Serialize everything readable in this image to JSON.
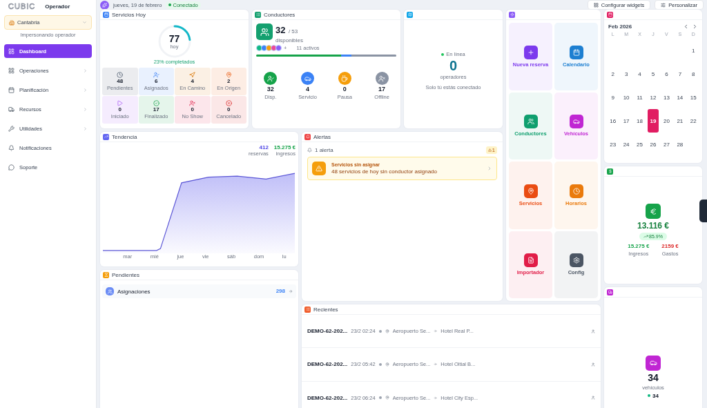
{
  "sidebar": {
    "logo": "CUBIC",
    "role": "Operador",
    "company": {
      "name": "Cantabria",
      "note": "Impersonando operador"
    },
    "items": [
      {
        "label": "Dashboard",
        "selected": true,
        "submenu": false
      },
      {
        "label": "Operaciones",
        "selected": false,
        "submenu": true
      },
      {
        "label": "Planificación",
        "selected": false,
        "submenu": true
      },
      {
        "label": "Recursos",
        "selected": false,
        "submenu": true
      },
      {
        "label": "Utilidades",
        "selected": false,
        "submenu": true
      },
      {
        "label": "Notificaciones",
        "selected": false,
        "submenu": false
      },
      {
        "label": "Soporte",
        "selected": false,
        "submenu": false
      }
    ]
  },
  "header": {
    "date": "jueves, 19 de febrero",
    "status": "Conectado",
    "buttons": [
      {
        "label": "Configurar widgets"
      },
      {
        "label": "Personalizar"
      }
    ]
  },
  "services": {
    "title": "Servicios Hoy",
    "total": "77",
    "total_note": "hoy",
    "level": 0.23,
    "progress": "23% completados",
    "tiles": [
      {
        "kind": "clock",
        "value": "48",
        "label": "Pendientes"
      },
      {
        "kind": "user-check",
        "value": "6",
        "label": "Asignados"
      },
      {
        "kind": "navigation",
        "value": "4",
        "label": "En Camino"
      },
      {
        "kind": "pin",
        "value": "2",
        "label": "En Origen"
      },
      {
        "kind": "play",
        "value": "0",
        "label": "Iniciado"
      },
      {
        "kind": "check",
        "value": "17",
        "label": "Finalizado"
      },
      {
        "kind": "user-x",
        "value": "0",
        "label": "No Show"
      },
      {
        "kind": "x",
        "value": "0",
        "label": "Cancelado"
      }
    ]
  },
  "drivers": {
    "title": "Conductores",
    "available": "32",
    "total": "/ 53",
    "available_label": "disponibles",
    "avatars": [
      {
        "color": "#10b981"
      },
      {
        "color": "#3b82f6"
      },
      {
        "color": "#f59e0b"
      },
      {
        "color": "#ec4899"
      },
      {
        "color": "#8b5cf6"
      }
    ],
    "more": "+",
    "active": "11 activos",
    "stats": [
      {
        "kind": "user-check",
        "value": "32",
        "label": "Disp.",
        "color": "#16a34a"
      },
      {
        "kind": "car",
        "value": "4",
        "label": "Servicio",
        "color": "#3b82f6"
      },
      {
        "kind": "coffee",
        "value": "0",
        "label": "Pausa",
        "color": "#f59e0b"
      },
      {
        "kind": "user-x",
        "value": "17",
        "label": "Offline",
        "color": "#8a93a3"
      }
    ]
  },
  "online": {
    "status": "En línea",
    "count": "0",
    "label": "operadores",
    "note": "Solo tú estás conectado"
  },
  "actions": [
    {
      "kind": "plus",
      "label": "Nueva reserva",
      "color": "#7c3aed"
    },
    {
      "kind": "calendar",
      "label": "Calendario",
      "color": "#1d7fd1"
    },
    {
      "kind": "users",
      "label": "Conductores",
      "color": "#0f9f6e"
    },
    {
      "kind": "car",
      "label": "Vehículos",
      "color": "#c026d3"
    },
    {
      "kind": "pin",
      "label": "Servicios",
      "color": "#ea4c12"
    },
    {
      "kind": "clock",
      "label": "Horarios",
      "color": "#ea7a0c"
    },
    {
      "kind": "file",
      "label": "Importador",
      "color": "#e11d48"
    },
    {
      "kind": "settings",
      "label": "Config",
      "color": "#4b5563"
    }
  ],
  "calendar": {
    "month": "Feb 2026",
    "weekdays": [
      "L",
      "M",
      "X",
      "J",
      "V",
      "S",
      "D"
    ],
    "weeks": [
      [
        {
          "day": "1",
          "selected": false
        }
      ],
      [
        {
          "day": "2",
          "selected": false
        },
        {
          "day": "3",
          "selected": false
        },
        {
          "day": "4",
          "selected": false
        },
        {
          "day": "5",
          "selected": false
        },
        {
          "day": "6",
          "selected": false
        },
        {
          "day": "7",
          "selected": false
        },
        {
          "day": "8",
          "selected": false
        }
      ],
      [
        {
          "day": "9",
          "selected": false
        },
        {
          "day": "10",
          "selected": false
        },
        {
          "day": "11",
          "selected": false
        },
        {
          "day": "12",
          "selected": false
        },
        {
          "day": "13",
          "selected": false
        },
        {
          "day": "14",
          "selected": false
        },
        {
          "day": "15",
          "selected": false
        }
      ],
      [
        {
          "day": "16",
          "selected": false
        },
        {
          "day": "17",
          "selected": false
        },
        {
          "day": "18",
          "selected": false
        },
        {
          "day": "19",
          "selected": true
        },
        {
          "day": "20",
          "selected": false
        },
        {
          "day": "21",
          "selected": false
        },
        {
          "day": "22",
          "selected": false
        }
      ],
      [
        {
          "day": "23",
          "selected": false
        },
        {
          "day": "24",
          "selected": false
        },
        {
          "day": "25",
          "selected": false
        },
        {
          "day": "26",
          "selected": false
        },
        {
          "day": "27",
          "selected": false
        },
        {
          "day": "28",
          "selected": false
        }
      ]
    ]
  },
  "trend": {
    "title": "Tendencia",
    "reservations": "412",
    "reservations_label": "reservas",
    "income": "15.275 €",
    "income_label": "ingresos",
    "x_labels": [
      "mar",
      "mié",
      "jue",
      "vie",
      "sáb",
      "dom",
      "lu"
    ]
  },
  "alerts": {
    "title": "Alertas",
    "summary": "1 alerta",
    "badge": "1",
    "items": [
      {
        "title": "Servicios sin asignar",
        "text": "48 servicios de hoy sin conductor asignado"
      }
    ]
  },
  "finance": {
    "total": "13.116 €",
    "trend": "85.9%",
    "income": "15.275 €",
    "income_label": "Ingresos",
    "expenses": "2159 €",
    "expenses_label": "Gastos"
  },
  "pending": {
    "title": "Pendientes",
    "items": [
      {
        "label": "Asignaciones",
        "count": "298"
      }
    ]
  },
  "recent": {
    "title": "Recientes",
    "rows": [
      {
        "code": "DEMO-62-202...",
        "time": "23/2 02:24",
        "origin": "Aeropuerto Se...",
        "destination": "Hotel Real P..."
      },
      {
        "code": "DEMO-62-202...",
        "time": "23/2 05:42",
        "origin": "Aeropuerto Se...",
        "destination": "Hotel Oltial B..."
      },
      {
        "code": "DEMO-62-202...",
        "time": "23/2 06:24",
        "origin": "Aeropuerto Se...",
        "destination": "Hotel City Esp..."
      }
    ]
  },
  "vehicles": {
    "count": "34",
    "label": "vehículos",
    "active": "34"
  }
}
